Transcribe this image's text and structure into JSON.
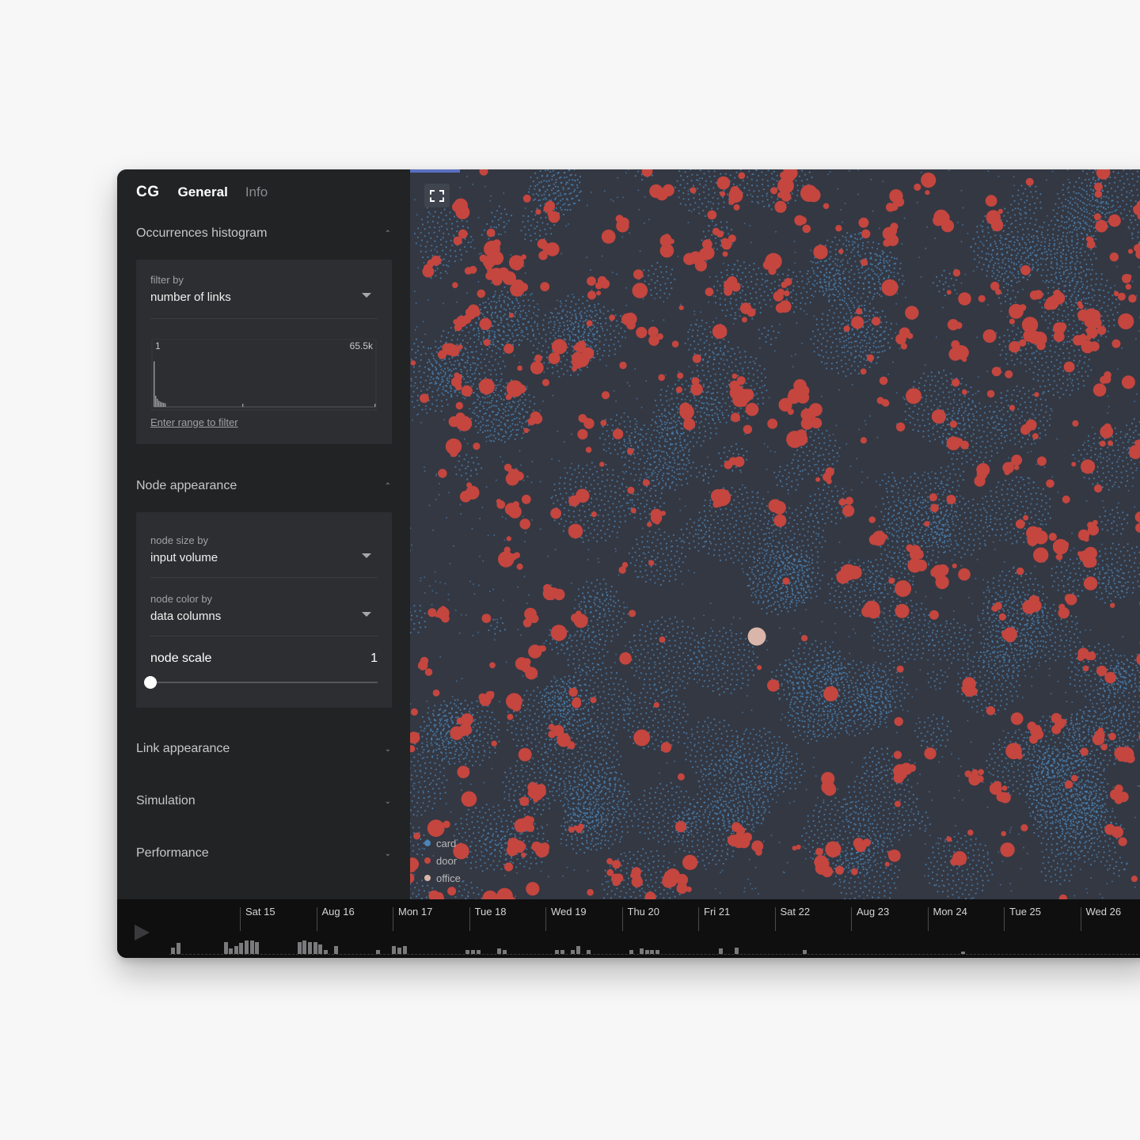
{
  "header": {
    "logo": "CG",
    "tabs": [
      {
        "label": "General",
        "active": true
      },
      {
        "label": "Info",
        "active": false
      }
    ]
  },
  "sections": {
    "histogram": {
      "title": "Occurrences histogram",
      "expanded": true,
      "filter_label": "filter by",
      "filter_value": "number of links",
      "range_min": "1",
      "range_max": "65.5k",
      "range_link": "Enter range to filter",
      "bars": [
        0.9,
        0.22,
        0.16,
        0.12,
        0.1,
        0.09,
        0.08,
        0.07
      ]
    },
    "node_appearance": {
      "title": "Node appearance",
      "expanded": true,
      "size_label": "node size by",
      "size_value": "input volume",
      "color_label": "node color by",
      "color_value": "data columns",
      "scale_label": "node scale",
      "scale_value": "1",
      "scale_fraction": 0.0
    },
    "link_appearance": {
      "title": "Link appearance",
      "expanded": false
    },
    "simulation": {
      "title": "Simulation",
      "expanded": false
    },
    "performance": {
      "title": "Performance",
      "expanded": false
    }
  },
  "graph": {
    "legend": [
      {
        "label": "card",
        "color": "#4a86b8"
      },
      {
        "label": "door",
        "color": "#c4463f"
      },
      {
        "label": "office",
        "color": "#d9b5aa"
      }
    ],
    "background": "#343843"
  },
  "timeline": {
    "play_icon": "play-icon",
    "labels": [
      "Sat 15",
      "Aug 16",
      "Mon 17",
      "Tue 18",
      "Wed 19",
      "Thu 20",
      "Fri 21",
      "Sat 22",
      "Aug 23",
      "Mon 24",
      "Tue 25",
      "Wed 26"
    ],
    "activity": [
      [
        0,
        0.5
      ],
      [
        1,
        0.8
      ],
      [
        10,
        0.9
      ],
      [
        11,
        0.4
      ],
      [
        12,
        0.6
      ],
      [
        13,
        0.8
      ],
      [
        14,
        1.0
      ],
      [
        15,
        1.0
      ],
      [
        16,
        0.9
      ],
      [
        24,
        0.9
      ],
      [
        25,
        1.0
      ],
      [
        26,
        0.9
      ],
      [
        27,
        0.9
      ],
      [
        28,
        0.7
      ],
      [
        29,
        0.3
      ],
      [
        31,
        0.6
      ],
      [
        39,
        0.3
      ],
      [
        42,
        0.6
      ],
      [
        43,
        0.5
      ],
      [
        44,
        0.6
      ],
      [
        56,
        0.3
      ],
      [
        57,
        0.3
      ],
      [
        58,
        0.3
      ],
      [
        62,
        0.4
      ],
      [
        63,
        0.3
      ],
      [
        73,
        0.3
      ],
      [
        74,
        0.3
      ],
      [
        76,
        0.3
      ],
      [
        77,
        0.6
      ],
      [
        79,
        0.3
      ],
      [
        87,
        0.3
      ],
      [
        89,
        0.4
      ],
      [
        90,
        0.3
      ],
      [
        91,
        0.3
      ],
      [
        92,
        0.3
      ],
      [
        104,
        0.4
      ],
      [
        107,
        0.5
      ],
      [
        120,
        0.3
      ],
      [
        150,
        0.2
      ]
    ]
  }
}
